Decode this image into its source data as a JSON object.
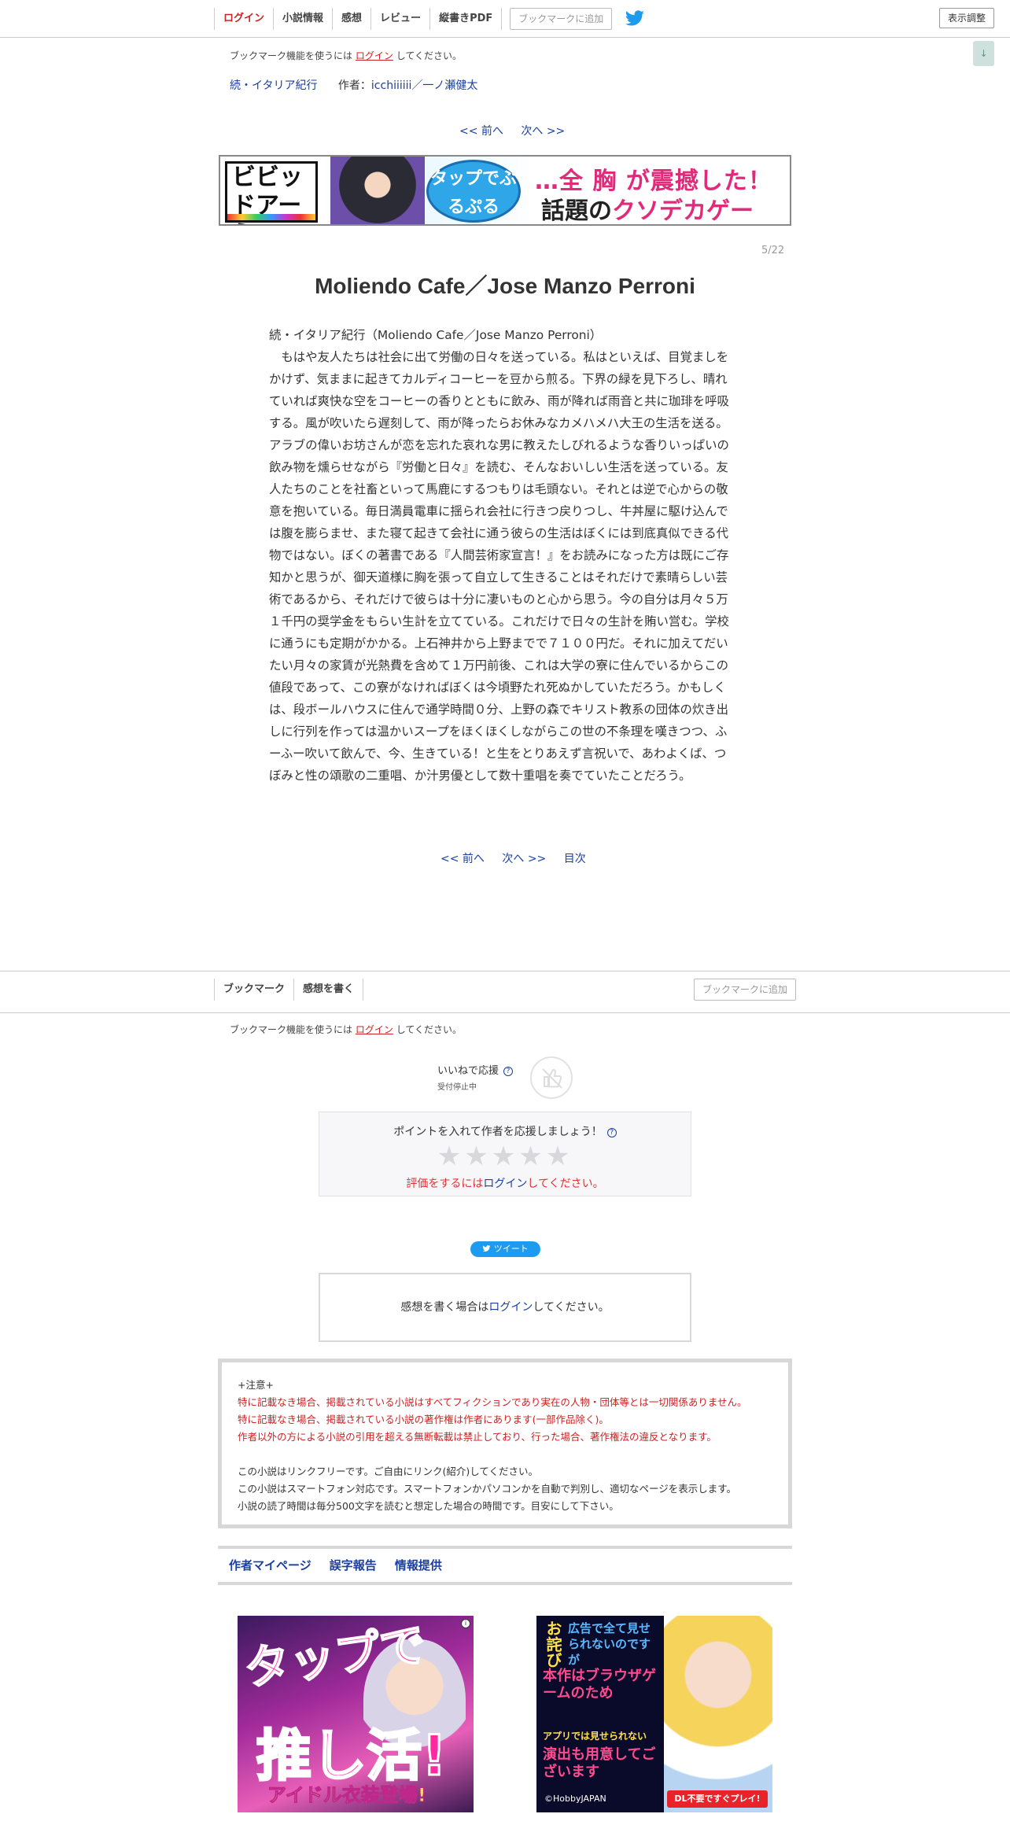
{
  "topnav": {
    "login": "ログイン",
    "novel_info": "小説情報",
    "impressions": "感想",
    "review": "レビュー",
    "vertical_pdf": "縦書きPDF",
    "bookmark_add": "ブックマークに追加",
    "display_settings": "表示調整"
  },
  "bookmark_notice": {
    "prefix": "ブックマーク機能を使うには",
    "login_link": "ログイン",
    "suffix": "してください。"
  },
  "series": {
    "title": "続・イタリア紀行",
    "author_label": "作者：",
    "author": "icchiiiiii／一ノ瀬健太"
  },
  "pager_top": {
    "prev": "<< 前へ",
    "next": "次へ >>"
  },
  "banner_top": {
    "brand": "ビビッドアーミー",
    "bubble": "タップでぷるぷる",
    "line1": "…全 胸 が震撼した！",
    "line2_a": "話題の",
    "line2_b": "クソデカ",
    "line2_c": "ゲーム！"
  },
  "page_counter": "5/22",
  "chapter": {
    "title": "Moliendo Cafe／Jose Manzo Perroni",
    "subtitle_line": "続・イタリア紀行（Moliendo Cafe／Jose Manzo Perroni）",
    "body": "　もはや友人たちは社会に出て労働の日々を送っている。私はといえば、目覚ましをかけず、気ままに起きてカルディコーヒーを豆から煎る。下界の緑を見下ろし、晴れていれば爽快な空をコーヒーの香りとともに飲み、雨が降れば雨音と共に珈琲を呼吸する。風が吹いたら遅刻して、雨が降ったらお休みなカメハメハ大王の生活を送る。アラブの偉いお坊さんが恋を忘れた哀れな男に教えたしびれるような香りいっぱいの飲み物を燻らせながら『労働と日々』を読む、そんなおいしい生活を送っている。友人たちのことを社畜といって馬鹿にするつもりは毛頭ない。それとは逆で心からの敬意を抱いている。毎日満員電車に揺られ会社に行きつ戻りつし、牛丼屋に駆け込んでは腹を膨らませ、また寝て起きて会社に通う彼らの生活はぼくには到底真似できる代物ではない。ぼくの著書である『人間芸術家宣言！』をお読みになった方は既にご存知かと思うが、御天道様に胸を張って自立して生きることはそれだけで素晴らしい芸術であるから、それだけで彼らは十分に凄いものと心から思う。今の自分は月々５万１千円の奨学金をもらい生計を立てている。これだけで日々の生計を賄い営む。学校に通うにも定期がかかる。上石神井から上野までで７１００円だ。それに加えてだいたい月々の家賃が光熱費を含めて１万円前後、これは大学の寮に住んでいるからこの値段であって、この寮がなければぼくは今頃野たれ死ぬかしていただろう。かもしくは、段ボールハウスに住んで通学時間０分、上野の森でキリスト教系の団体の炊き出しに行列を作っては温かいスープをほくほくしながらこの世の不条理を嘆きつつ、ふーふー吹いて飲んで、今、生きている！と生をとりあえず言祝いで、あわよくば、つぼみと性の頌歌の二重唱、か汁男優として数十重唱を奏でていたことだろう。"
  },
  "pager_bottom": {
    "prev": "<< 前へ",
    "next": "次へ >>",
    "toc": "目次"
  },
  "bottomnav": {
    "bookmark": "ブックマーク",
    "write_impression": "感想を書く",
    "bookmark_add": "ブックマークに追加"
  },
  "like": {
    "label": "いいねで応援",
    "sub": "受付停止中",
    "help": "?"
  },
  "rating": {
    "prompt": "ポイントを入れて作者を応援しましょう！",
    "help": "?",
    "stars": "★★★★★",
    "login_prefix": "評価をするには",
    "login_link": "ログイン",
    "login_suffix": "してください。"
  },
  "tweet_label": "ツイート",
  "impression_box": {
    "prefix": "感想を書く場合は",
    "login_link": "ログイン",
    "suffix": "してください。"
  },
  "notes": {
    "heading": "+注意+",
    "red1": "特に記載なき場合、掲載されている小説はすべてフィクションであり実在の人物・団体等とは一切関係ありません。",
    "red2": "特に記載なき場合、掲載されている小説の著作権は作者にあります(一部作品除く)。",
    "red3": "作者以外の方による小説の引用を超える無断転載は禁止しており、行った場合、著作権法の違反となります。",
    "n1": "この小説はリンクフリーです。ご自由にリンク(紹介)してください。",
    "n2": "この小説はスマートフォン対応です。スマートフォンかパソコンかを自動で判別し、適切なページを表示します。",
    "n3": "小説の読了時間は毎分500文字を読むと想定した場合の時間です。目安にして下さい。"
  },
  "footer_links": {
    "author_page": "作者マイページ",
    "typo_report": "誤字報告",
    "info": "情報提供"
  },
  "ad_left": {
    "t1": "タップで",
    "t2": "推し活!",
    "t3": "アイドル衣装登場!"
  },
  "ad_right": {
    "l1": "お詫び",
    "l2": "広告で全て見せられないのですが",
    "l3": "本作はブラウザゲームのため",
    "l4": "アプリでは見せられない",
    "l5": "演出も用意してございます",
    "l6": "©HobbyJAPAN",
    "cta": "DL不要ですぐプレイ!"
  },
  "scroll_tab": "↓"
}
